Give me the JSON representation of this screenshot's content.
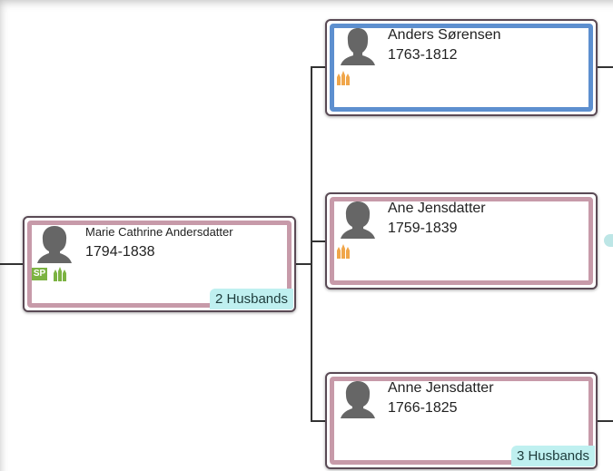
{
  "persons": {
    "focus": {
      "name": "Marie Cathrine Andersdatter",
      "dates": "1794-1838",
      "sp_label": "SP",
      "badge": "2 Husbands"
    },
    "father": {
      "name": "Anders Sørensen",
      "dates": "1763-1812"
    },
    "mother": {
      "name": "Ane Jensdatter",
      "dates": "1759-1839"
    },
    "other": {
      "name": "Anne Jensdatter",
      "dates": "1766-1825",
      "badge": "3 Husbands"
    }
  },
  "colors": {
    "female_border": "#c79aa9",
    "male_border": "#5d8fcf",
    "badge_bg": "#bff0f0",
    "sp_badge": "#7cb342",
    "temple_green": "#7cb342",
    "temple_orange": "#f0a64a",
    "avatar_gray": "#666666"
  },
  "icons": {
    "avatar": "person-silhouette-icon",
    "temple": "temple-icon",
    "sp": "sp-badge"
  }
}
